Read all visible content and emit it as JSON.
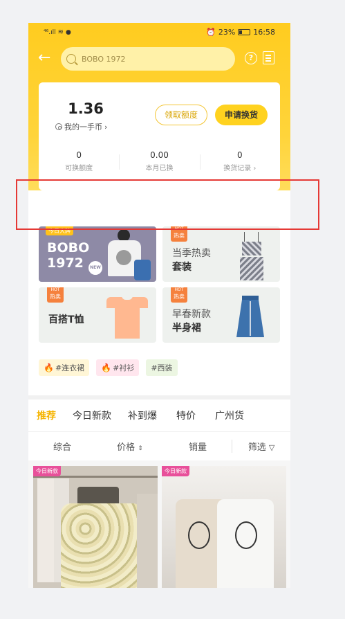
{
  "status_bar": {
    "left": "⁴⁶.ıll",
    "battery": "23%",
    "time": "16:58"
  },
  "header": {
    "search_text": "BOBO 1972"
  },
  "card": {
    "balance": "1.36",
    "balance_label": "我的一手币",
    "btn_claim": "领取额度",
    "btn_apply": "申请换货",
    "stats": [
      {
        "value": "0",
        "label": "可换额度"
      },
      {
        "value": "0.00",
        "label": "本月已换"
      },
      {
        "value": "0",
        "label": "换货记录"
      }
    ]
  },
  "banners": {
    "b1": {
      "tag": "今日大牌",
      "title_line1": "BOBO",
      "title_line2": "1972",
      "badge": "NEW"
    },
    "b2": {
      "hot": "HOT",
      "hot_zh": "热卖",
      "sub": "当季热卖",
      "main": "套装"
    },
    "b3": {
      "hot": "HOT",
      "hot_zh": "热卖",
      "main": "百搭T恤"
    },
    "b4": {
      "hot": "HOT",
      "hot_zh": "热卖",
      "sub": "早春新款",
      "main": "半身裙"
    }
  },
  "chips": [
    "#连衣裙",
    "#衬衫",
    "#西装"
  ],
  "category_tabs": [
    "推荐",
    "今日新款",
    "补到爆",
    "特价",
    "广州货"
  ],
  "sort_bar": [
    "综合",
    "价格",
    "销量",
    "筛选"
  ],
  "products": [
    {
      "tag": "今日新款"
    },
    {
      "tag": "今日新款"
    }
  ],
  "colors": {
    "accent": "#ffd21f",
    "tab_active": "#f5b400",
    "highlight_box": "#e53935"
  }
}
